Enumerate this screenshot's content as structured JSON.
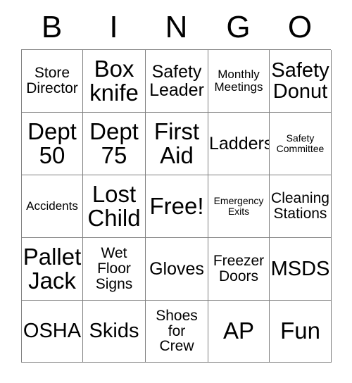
{
  "card": {
    "header": {
      "letters": [
        "B",
        "I",
        "N",
        "G",
        "O"
      ]
    },
    "rows": [
      [
        {
          "text": "Store\nDirector",
          "size": "fs-sm"
        },
        {
          "text": "Box\nknife",
          "size": "fs-xl"
        },
        {
          "text": "Safety\nLeader",
          "size": "fs-md"
        },
        {
          "text": "Monthly\nMeetings",
          "size": "fs-xs"
        },
        {
          "text": "Safety\nDonut",
          "size": "fs-lg"
        }
      ],
      [
        {
          "text": "Dept\n50",
          "size": "fs-xl"
        },
        {
          "text": "Dept\n75",
          "size": "fs-xl"
        },
        {
          "text": "First\nAid",
          "size": "fs-xl"
        },
        {
          "text": "Ladders",
          "size": "fs-md"
        },
        {
          "text": "Safety\nCommittee",
          "size": "fs-xxs"
        }
      ],
      [
        {
          "text": "Accidents",
          "size": "fs-xs"
        },
        {
          "text": "Lost\nChild",
          "size": "fs-xl"
        },
        {
          "text": "Free!",
          "size": "fs-xl"
        },
        {
          "text": "Emergency\nExits",
          "size": "fs-xxs"
        },
        {
          "text": "Cleaning\nStations",
          "size": "fs-sm"
        }
      ],
      [
        {
          "text": "Pallet\nJack",
          "size": "fs-xl"
        },
        {
          "text": "Wet\nFloor\nSigns",
          "size": "fs-sm"
        },
        {
          "text": "Gloves",
          "size": "fs-md"
        },
        {
          "text": "Freezer\nDoors",
          "size": "fs-sm"
        },
        {
          "text": "MSDS",
          "size": "fs-lg"
        }
      ],
      [
        {
          "text": "OSHA",
          "size": "fs-lg"
        },
        {
          "text": "Skids",
          "size": "fs-lg"
        },
        {
          "text": "Shoes\nfor\nCrew",
          "size": "fs-sm"
        },
        {
          "text": "AP",
          "size": "fs-xl"
        },
        {
          "text": "Fun",
          "size": "fs-xl"
        }
      ]
    ]
  },
  "colors": {
    "border": "#808080",
    "text": "#000000",
    "background": "#ffffff"
  }
}
